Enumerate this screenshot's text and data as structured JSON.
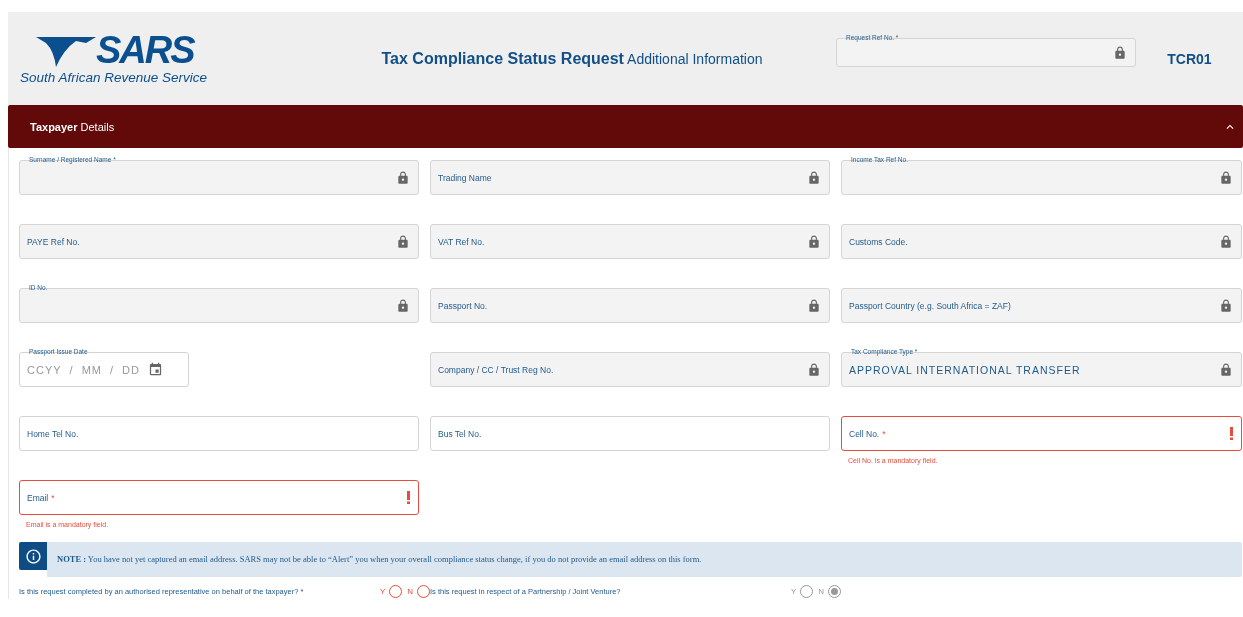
{
  "header": {
    "logo": {
      "wordmark": "SARS",
      "subtitle": "South African Revenue Service"
    },
    "title": "**Tax Compliance Status Request** Additional Information",
    "ref_field": {
      "label": "Request Ref No. *",
      "locked": true
    },
    "form_code": "TCR01"
  },
  "section": {
    "title": "**Taxpayer** Details",
    "expanded": true
  },
  "fields": [
    {
      "kind": "text",
      "label": "Surname / Registered Name *",
      "floating": true,
      "locked": true
    },
    {
      "kind": "text",
      "label": "Trading Name",
      "floating": false,
      "locked": true
    },
    {
      "kind": "text",
      "label": "Income Tax Ref No.",
      "floating": true,
      "locked": true
    },
    {
      "kind": "text",
      "label": "PAYE Ref No.",
      "floating": false,
      "locked": true
    },
    {
      "kind": "text",
      "label": "VAT Ref No.",
      "floating": false,
      "locked": true
    },
    {
      "kind": "text",
      "label": "Customs Code.",
      "floating": false,
      "locked": true
    },
    {
      "kind": "text",
      "label": "ID No.",
      "floating": true,
      "locked": true
    },
    {
      "kind": "text",
      "label": "Passport No.",
      "floating": false,
      "locked": true
    },
    {
      "kind": "text",
      "label": "Passport Country (e.g. South Africa = ZAF)",
      "floating": false,
      "locked": true
    },
    {
      "kind": "date",
      "label": "Passport Issue Date",
      "floating": true,
      "locked": false,
      "placeholder_parts": [
        "CCYY",
        "/",
        "MM",
        "/",
        "DD"
      ]
    },
    {
      "kind": "text",
      "label": "Company / CC / Trust Reg No.",
      "floating": false,
      "locked": true
    },
    {
      "kind": "text",
      "label": "Tax Compliance Type *",
      "floating": true,
      "locked": true,
      "value": "APPROVAL INTERNATIONAL TRANSFER"
    },
    {
      "kind": "text",
      "label": "Home Tel No.",
      "floating": false,
      "locked": false
    },
    {
      "kind": "text",
      "label": "Bus Tel No.",
      "floating": false,
      "locked": false
    },
    {
      "kind": "text",
      "label": "Cell No.",
      "required_mark": "*",
      "floating": false,
      "locked": false,
      "invalid": true,
      "error": "Cell No. is a mandatory field."
    },
    {
      "kind": "text",
      "label": "Email",
      "required_mark": "*",
      "floating": false,
      "locked": false,
      "invalid": true,
      "error": "Email is a mandatory field."
    }
  ],
  "note": "**NOTE :** You have not yet captured an email address. SARS may not be able to “Alert” you when your overall compliance status change, if you do not provide an email address on this form.",
  "questions": [
    {
      "label": "Is this request completed by an authorised representative on behalf of the taxpayer? *",
      "invalid": true,
      "disabled": false,
      "options": [
        {
          "label": "Y",
          "selected": false
        },
        {
          "label": "N",
          "selected": false
        }
      ]
    },
    {
      "label": "Is this request in respect of a Partnership / Joint Venture?",
      "invalid": false,
      "disabled": true,
      "options": [
        {
          "label": "Y",
          "selected": false
        },
        {
          "label": "N",
          "selected": true
        }
      ]
    }
  ]
}
